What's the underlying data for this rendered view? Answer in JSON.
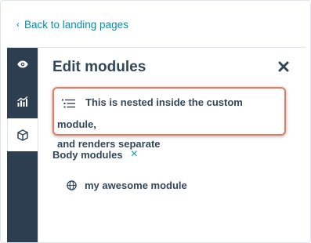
{
  "topbar": {
    "back_label": "Back to landing pages"
  },
  "rail": {
    "items": [
      "eye-icon",
      "chart-icon",
      "cube-icon"
    ],
    "active": "cube-icon"
  },
  "panel": {
    "title": "Edit modules",
    "nested_item": {
      "line1": "This is nested inside the custom module,",
      "line2": "and renders separate"
    },
    "section_label": "Body modules",
    "section_clear": "×",
    "module_label": "my awesome module"
  },
  "colors": {
    "rail": "#2d3e50",
    "link": "#0091ae",
    "highlight": "#e8785e",
    "text": "#33475b"
  }
}
